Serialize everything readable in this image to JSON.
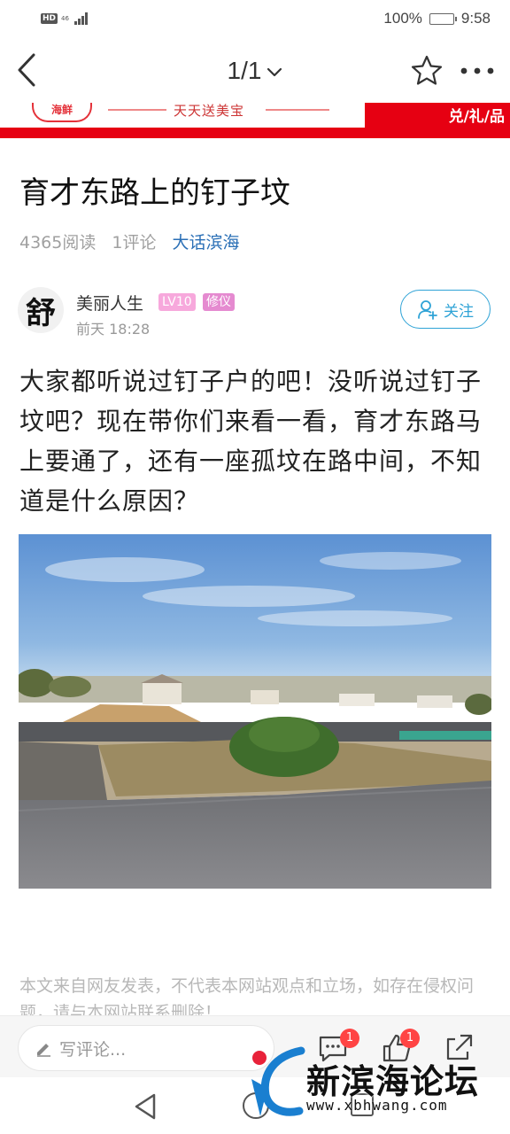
{
  "status_bar": {
    "hd": "HD",
    "network": "46",
    "battery": "100%",
    "battery_level": 1.0,
    "time": "9:58"
  },
  "nav": {
    "page_indicator": "1/1",
    "back_icon": "chevron-left-icon",
    "favorite_icon": "star-icon",
    "more_icon": "more-dots-icon"
  },
  "banner": {
    "logo_text": "海鲜",
    "slogan": "天天送美宝",
    "right_text": "兑/礼/品",
    "accent_color": "#e60012"
  },
  "article": {
    "title": "育才东路上的钉子坟",
    "reads": "4365阅读",
    "comments": "1评论",
    "forum": "大话滨海",
    "body": "大家都听说过钉子户的吧！没听说过钉子坟吧？现在带你们来看一看，育才东路马上要通了，还有一座孤坟在路中间，不知道是什么原因？",
    "disclaimer": "本文来自网友发表，不代表本网站观点和立场，如存在侵权问题，请与本网站联系删除！"
  },
  "author": {
    "avatar_char": "舒",
    "name": "美丽人生",
    "level": "LV10",
    "title": "修仪",
    "time": "前天 18:28",
    "follow_label": "关注"
  },
  "comment_bar": {
    "placeholder": "写评论...",
    "comment_badge": "1",
    "like_badge": "1"
  },
  "watermark": {
    "name": "新滨海论坛",
    "url": "www.xbhwang.com"
  }
}
